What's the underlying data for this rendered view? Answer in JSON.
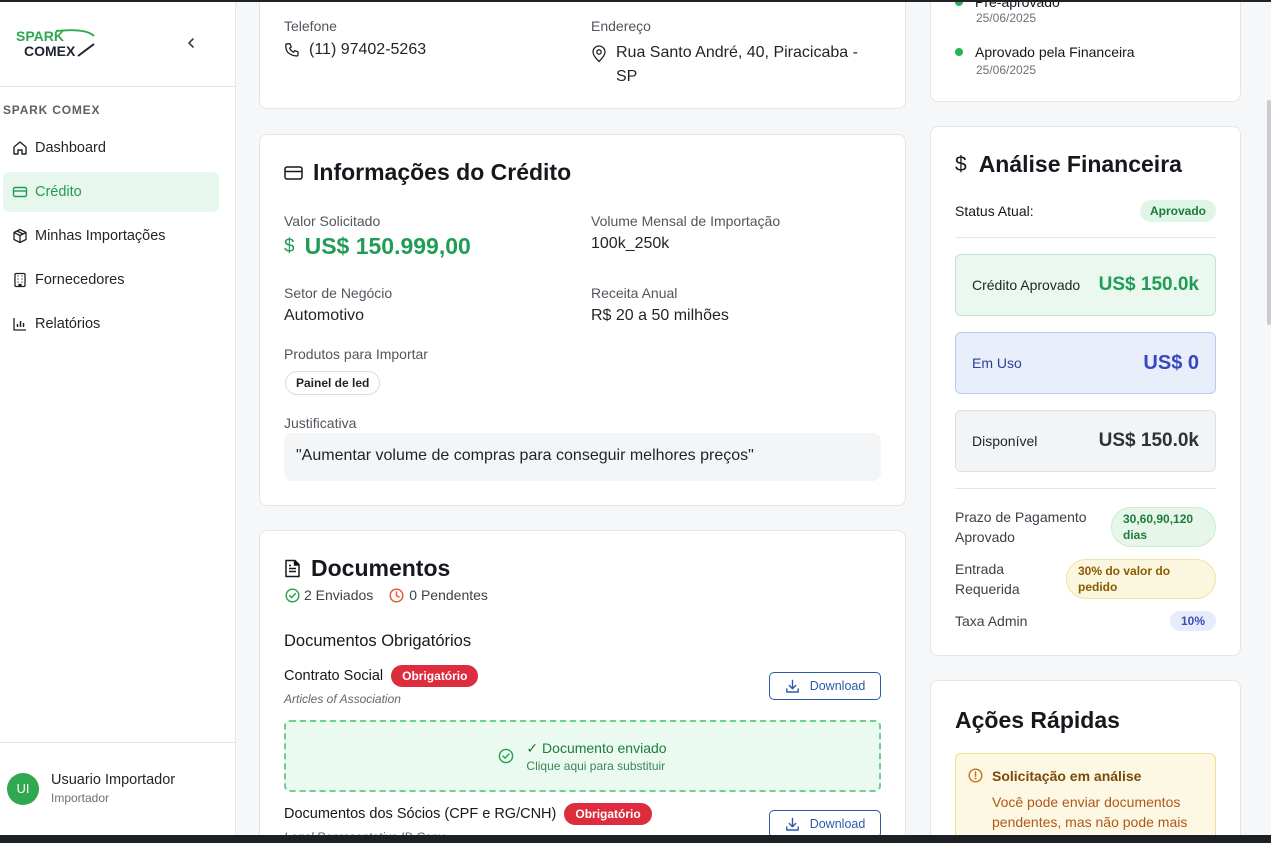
{
  "brand": {
    "logo_line1": "SPARK",
    "logo_line2": "COMEX",
    "accent": "#2fa84f"
  },
  "sidebar": {
    "section": "SPARK COMEX",
    "items": [
      {
        "label": "Dashboard",
        "icon": "home-icon"
      },
      {
        "label": "Crédito",
        "icon": "credit-card-icon",
        "active": true
      },
      {
        "label": "Minhas Importações",
        "icon": "package-icon"
      },
      {
        "label": "Fornecedores",
        "icon": "building-icon"
      },
      {
        "label": "Relatórios",
        "icon": "bar-chart-icon"
      }
    ],
    "user": {
      "initials": "UI",
      "name": "Usuario Importador",
      "role": "Importador"
    }
  },
  "contact": {
    "phone_label": "Telefone",
    "phone": "(11) 97402-5263",
    "address_label": "Endereço",
    "address_line1": "Rua Santo André, 40, Piracicaba -",
    "address_line2": "SP"
  },
  "credit_info": {
    "title": "Informações do Crédito",
    "valor_label": "Valor Solicitado",
    "valor": "US$ 150.999,00",
    "volume_label": "Volume Mensal de Importação",
    "volume": "100k_250k",
    "setor_label": "Setor de Negócio",
    "setor": "Automotivo",
    "receita_label": "Receita Anual",
    "receita": "R$ 20 a 50 milhões",
    "produtos_label": "Produtos para Importar",
    "produtos": [
      "Painel de led"
    ],
    "justificativa_label": "Justificativa",
    "justificativa": "\"Aumentar volume de compras para conseguir melhores preços\""
  },
  "documents": {
    "title": "Documentos",
    "sent": "2 Enviados",
    "pending": "0 Pendentes",
    "required_title": "Documentos Obrigatórios",
    "items": [
      {
        "name": "Contrato Social",
        "badge": "Obrigatório",
        "subtitle": "Articles of Association",
        "download": "Download",
        "upload_title": "✓ Documento enviado",
        "upload_sub": "Clique aqui para substituir"
      },
      {
        "name": "Documentos dos Sócios (CPF e RG/CNH)",
        "badge": "Obrigatório",
        "subtitle": "Legal Representative ID Copy",
        "download": "Download"
      }
    ]
  },
  "timeline": {
    "items": [
      {
        "label": "Pré-aprovado",
        "date": "25/06/2025"
      },
      {
        "label": "Aprovado pela Financeira",
        "date": "25/06/2025"
      }
    ]
  },
  "analise": {
    "title": "Análise Financeira",
    "status_label": "Status Atual:",
    "status": "Aprovado",
    "credito_label": "Crédito Aprovado",
    "credito": "US$ 150.0k",
    "em_uso_label": "Em Uso",
    "em_uso": "US$ 0",
    "disponivel_label": "Disponível",
    "disponivel": "US$ 150.0k",
    "prazo_label_1": "Prazo de Pagamento",
    "prazo_label_2": "Aprovado",
    "prazo_1": "30,60,90,120",
    "prazo_2": "dias",
    "entrada_label_1": "Entrada",
    "entrada_label_2": "Requerida",
    "entrada_1": "30% do valor do",
    "entrada_2": "pedido",
    "taxa_label": "Taxa Admin",
    "taxa": "10%"
  },
  "acoes": {
    "title": "Ações Rápidas",
    "alert_title": "Solicitação em análise",
    "alert_line1": "Você pode enviar documentos",
    "alert_line2": "pendentes, mas não pode mais"
  }
}
